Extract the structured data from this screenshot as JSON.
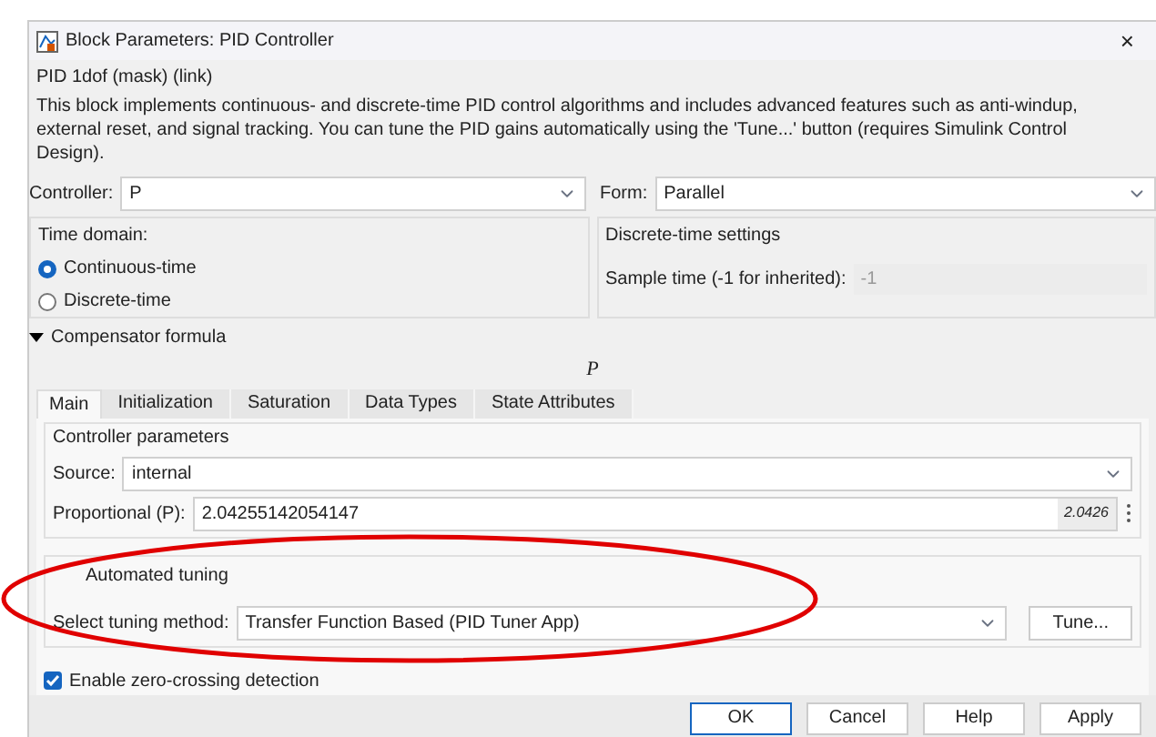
{
  "window": {
    "title": "Block Parameters: PID Controller",
    "close": "×"
  },
  "mask_title": "PID 1dof (mask) (link)",
  "description": "This block implements continuous- and discrete-time PID control algorithms and includes advanced features such as anti-windup, external reset, and signal tracking. You can tune the PID gains automatically using the 'Tune...' button (requires Simulink Control Design).",
  "controller": {
    "label": "Controller:",
    "value": "P"
  },
  "form": {
    "label": "Form:",
    "value": "Parallel"
  },
  "time_domain": {
    "title": "Time domain:",
    "options": [
      {
        "label": "Continuous-time",
        "selected": true
      },
      {
        "label": "Discrete-time",
        "selected": false
      }
    ]
  },
  "discrete_settings": {
    "title": "Discrete-time settings",
    "sample_time": {
      "label": "Sample time (-1 for inherited):",
      "value": "-1",
      "disabled": true
    }
  },
  "compensator": {
    "label": "Compensator formula",
    "expanded": true,
    "formula": "P"
  },
  "tabs": [
    {
      "label": "Main",
      "selected": true
    },
    {
      "label": "Initialization",
      "selected": false
    },
    {
      "label": "Saturation",
      "selected": false
    },
    {
      "label": "Data Types",
      "selected": false
    },
    {
      "label": "State Attributes",
      "selected": false
    }
  ],
  "controller_parameters": {
    "title": "Controller parameters",
    "source": {
      "label": "Source:",
      "value": "internal"
    },
    "proportional": {
      "label": "Proportional (P):",
      "value": "2.04255142054147",
      "badge": "2.0426"
    }
  },
  "automated_tuning": {
    "title": "Automated tuning",
    "method": {
      "label": "Select tuning method:",
      "value": "Transfer Function Based (PID Tuner App)"
    },
    "button": "Tune..."
  },
  "zero_crossing": {
    "label": "Enable zero-crossing detection",
    "checked": true
  },
  "buttons": [
    "OK",
    "Cancel",
    "Help",
    "Apply"
  ],
  "annotation": {
    "kind": "ellipse",
    "color": "#e00000"
  }
}
